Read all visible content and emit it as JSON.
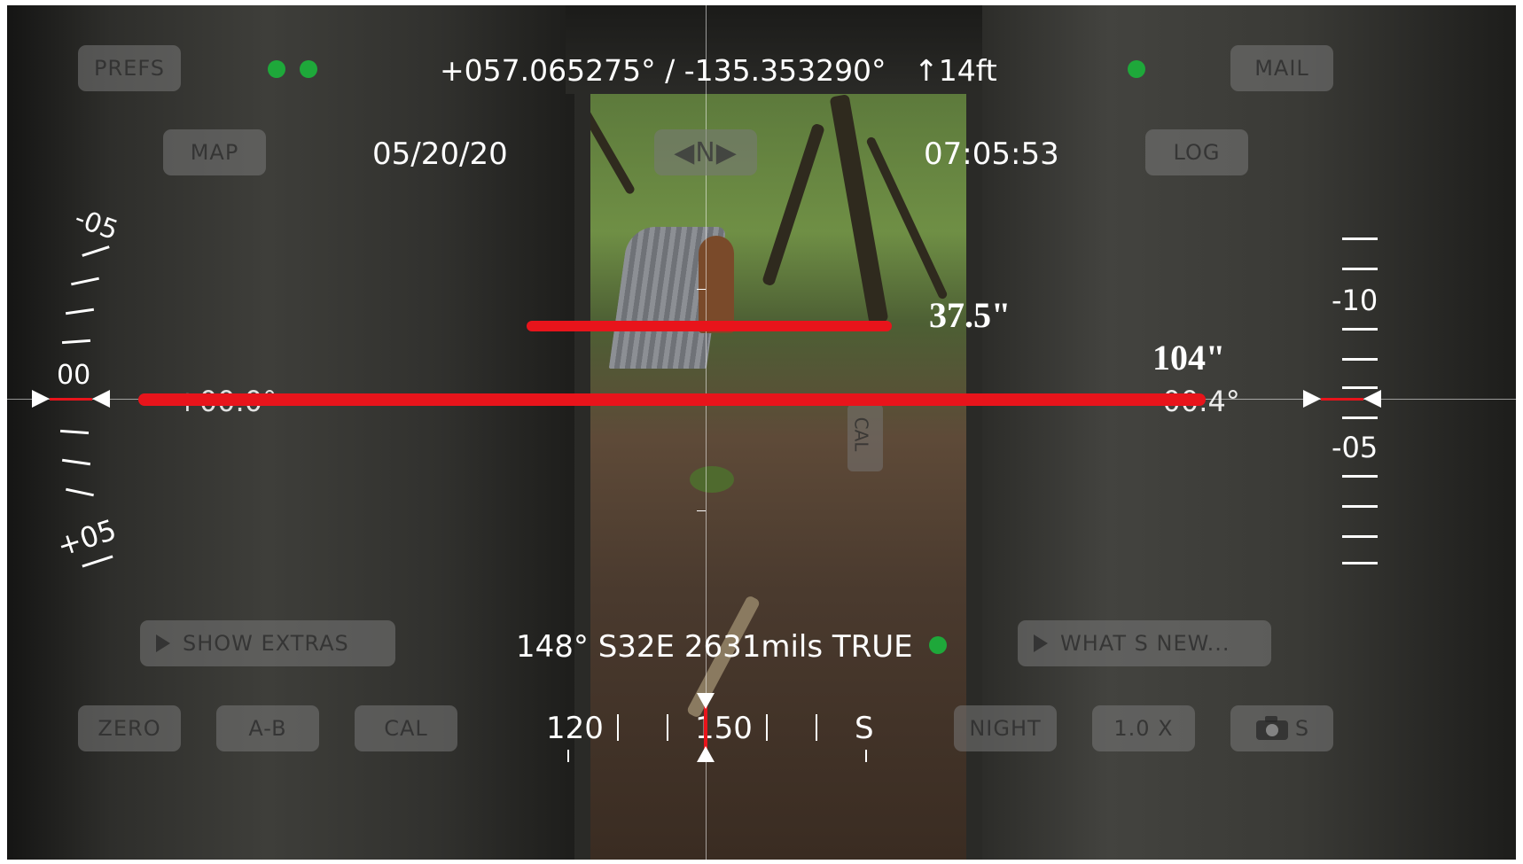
{
  "coordinates": {
    "text": "+057.065275° / -135.353290°",
    "altitude": "↑14ft"
  },
  "date": "05/20/20",
  "time": "07:05:53",
  "compass_indicator": "◀N▶",
  "left_angle": "+00.0°",
  "right_angle": "-00.4°",
  "heading_readout": "148° S32E 2631mils TRUE",
  "left_scale": {
    "top_label": "-05",
    "center_label": "00",
    "bottom_label": "+05"
  },
  "right_scale": {
    "upper_label": "-10",
    "lower_label": "-05"
  },
  "heading_tape": {
    "labels": [
      "120",
      "150",
      "S"
    ]
  },
  "measurements": {
    "upper": "37.5\"",
    "lower": "104\""
  },
  "side_tab": "CAL",
  "buttons": {
    "prefs": "PREFS",
    "mail": "MAIL",
    "map": "MAP",
    "log": "LOG",
    "show_extras": "SHOW EXTRAS",
    "whats_new": "WHAT S NEW...",
    "zero": "ZERO",
    "ab": "A-B",
    "cal": "CAL",
    "night": "NIGHT",
    "zoom": "1.0 X",
    "camera_suffix": "S"
  },
  "colors": {
    "indicator_green": "#1ea83a",
    "annotation_red": "#e8141b",
    "hud_text": "#ffffff"
  },
  "icons": [
    "camera-icon",
    "play-icon",
    "status-dot"
  ]
}
